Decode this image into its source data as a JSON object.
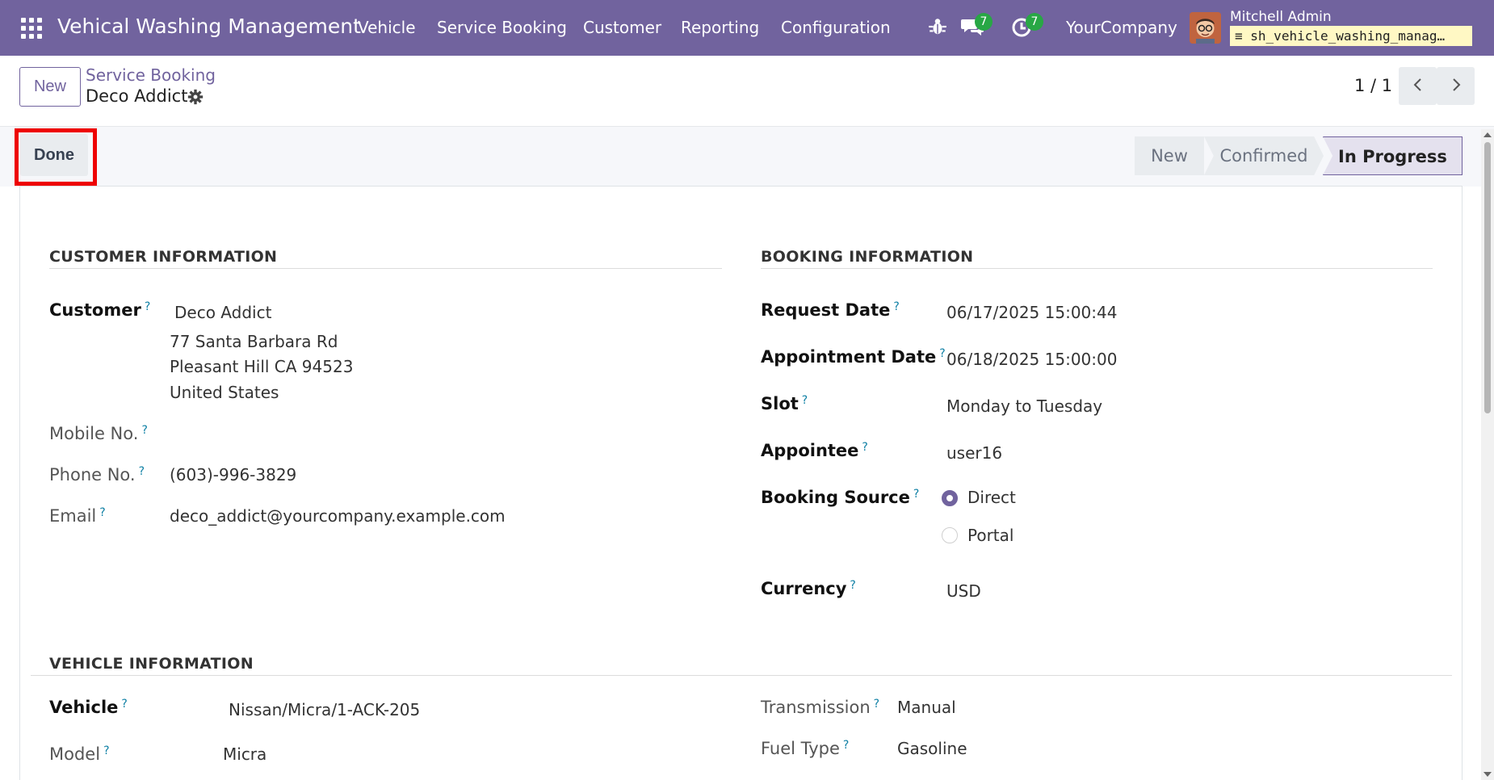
{
  "navbar": {
    "app_title": "Vehical Washing Management",
    "menus": [
      "Vehicle",
      "Service Booking",
      "Customer",
      "Reporting",
      "Configuration"
    ],
    "messages_count": "7",
    "activities_count": "7",
    "company": "YourCompany",
    "user_name": "Mitchell Admin",
    "database": "sh_vehicle_washing_manag…"
  },
  "control_panel": {
    "new_label": "New",
    "breadcrumb": "Service Booking",
    "record_title": "Deco Addict",
    "pager": "1 / 1"
  },
  "statusbar": {
    "done_label": "Done",
    "stages": [
      "New",
      "Confirmed",
      "In Progress"
    ],
    "active_stage": "In Progress"
  },
  "customer_info": {
    "title": "CUSTOMER INFORMATION",
    "customer_label": "Customer",
    "customer_name": "Deco Addict",
    "address_line1": "77 Santa Barbara Rd",
    "address_line2": "Pleasant Hill CA 94523",
    "address_line3": "United States",
    "mobile_label": "Mobile No.",
    "mobile_value": "",
    "phone_label": "Phone No.",
    "phone_value": "(603)-996-3829",
    "email_label": "Email",
    "email_value": "deco_addict@yourcompany.example.com"
  },
  "booking_info": {
    "title": "BOOKING INFORMATION",
    "request_date_label": "Request Date",
    "request_date_value": "06/17/2025 15:00:44",
    "appointment_date_label": "Appointment Date",
    "appointment_date_value": "06/18/2025 15:00:00",
    "slot_label": "Slot",
    "slot_value": "Monday to Tuesday",
    "appointee_label": "Appointee",
    "appointee_value": "user16",
    "booking_source_label": "Booking Source",
    "booking_source_options": [
      "Direct",
      "Portal"
    ],
    "booking_source_selected": "Direct",
    "currency_label": "Currency",
    "currency_value": "USD"
  },
  "vehicle_info": {
    "title": "VEHICLE INFORMATION",
    "vehicle_label": "Vehicle",
    "vehicle_value": "Nissan/Micra/1-ACK-205",
    "model_label": "Model",
    "model_value": "Micra",
    "transmission_label": "Transmission",
    "transmission_value": "Manual",
    "fuel_type_label": "Fuel Type",
    "fuel_type_value": "Gasoline"
  },
  "help_marker": "?",
  "colors": {
    "brand": "#71639e",
    "badge": "#28a745",
    "highlight": "#ee0000",
    "help": "#0d7fa4"
  }
}
